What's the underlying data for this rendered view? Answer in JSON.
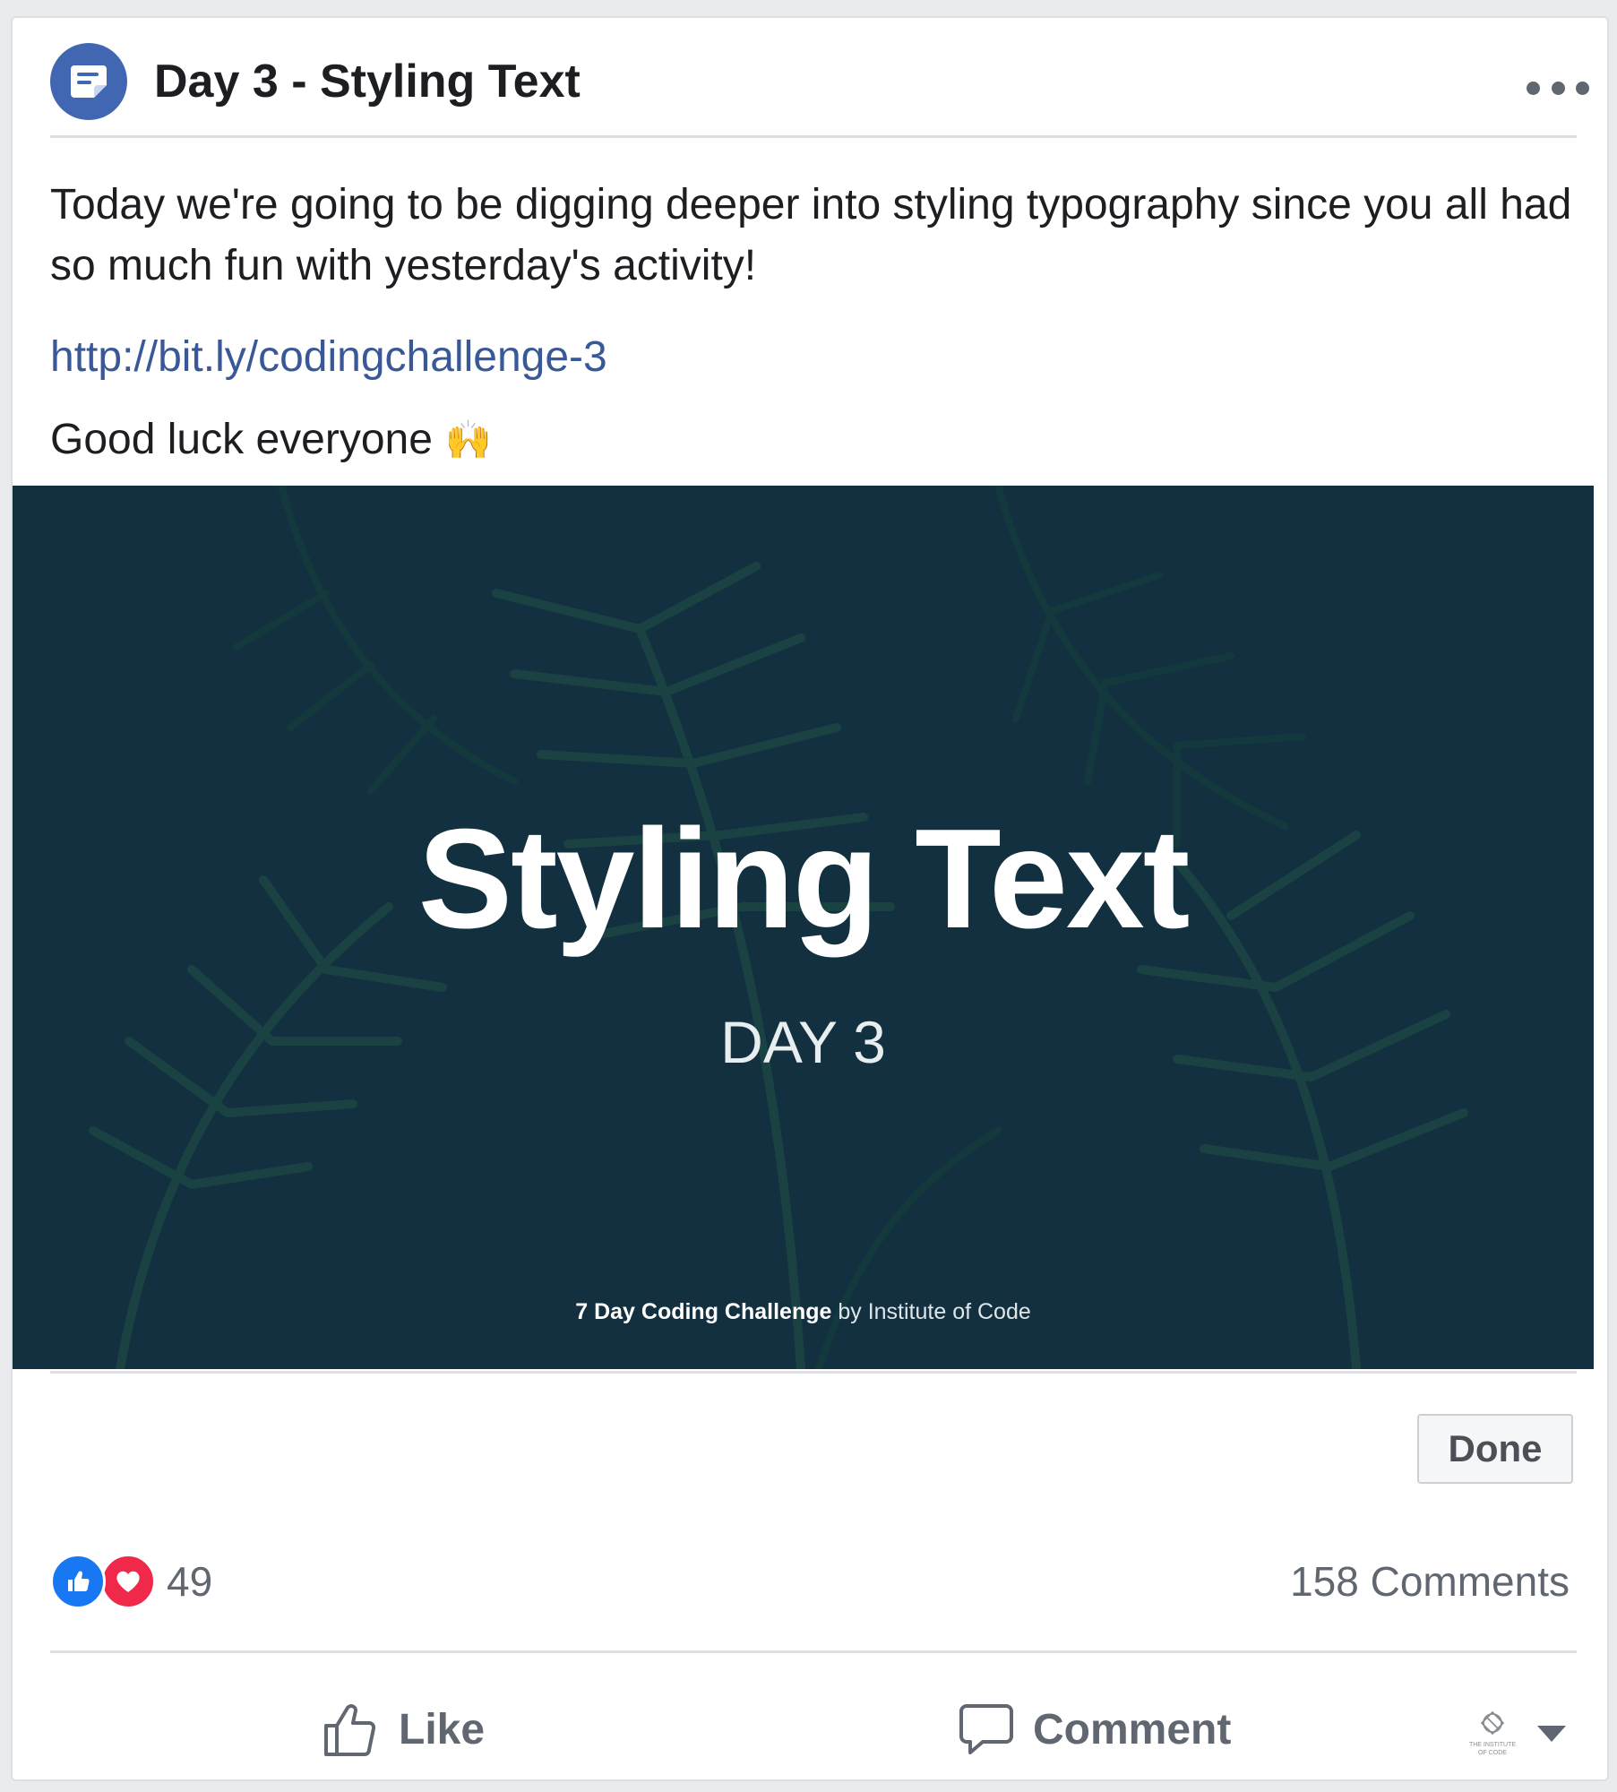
{
  "post": {
    "title": "Day 3 - Styling Text",
    "body": "Today we're going to be digging deeper into styling typography since you all had so much fun with yesterday's activity!",
    "link": "http://bit.ly/codingchallenge-3",
    "closing": "Good luck everyone",
    "closing_emoji": "🙌"
  },
  "banner": {
    "title": "Styling Text",
    "day": "DAY 3",
    "credit_bold": "7 Day Coding Challenge",
    "credit_rest": "by Institute of Code",
    "background": "#12303f"
  },
  "done_label": "Done",
  "reactions": {
    "count": "49",
    "types": [
      "like",
      "love"
    ]
  },
  "comments_count": "158 Comments",
  "actions": {
    "like": "Like",
    "comment": "Comment"
  },
  "page_avatar_text": "THE INSTITUTE OF CODE",
  "colors": {
    "brand": "#4267b2",
    "link": "#385898",
    "like": "#1877f2",
    "love": "#f0284a"
  }
}
